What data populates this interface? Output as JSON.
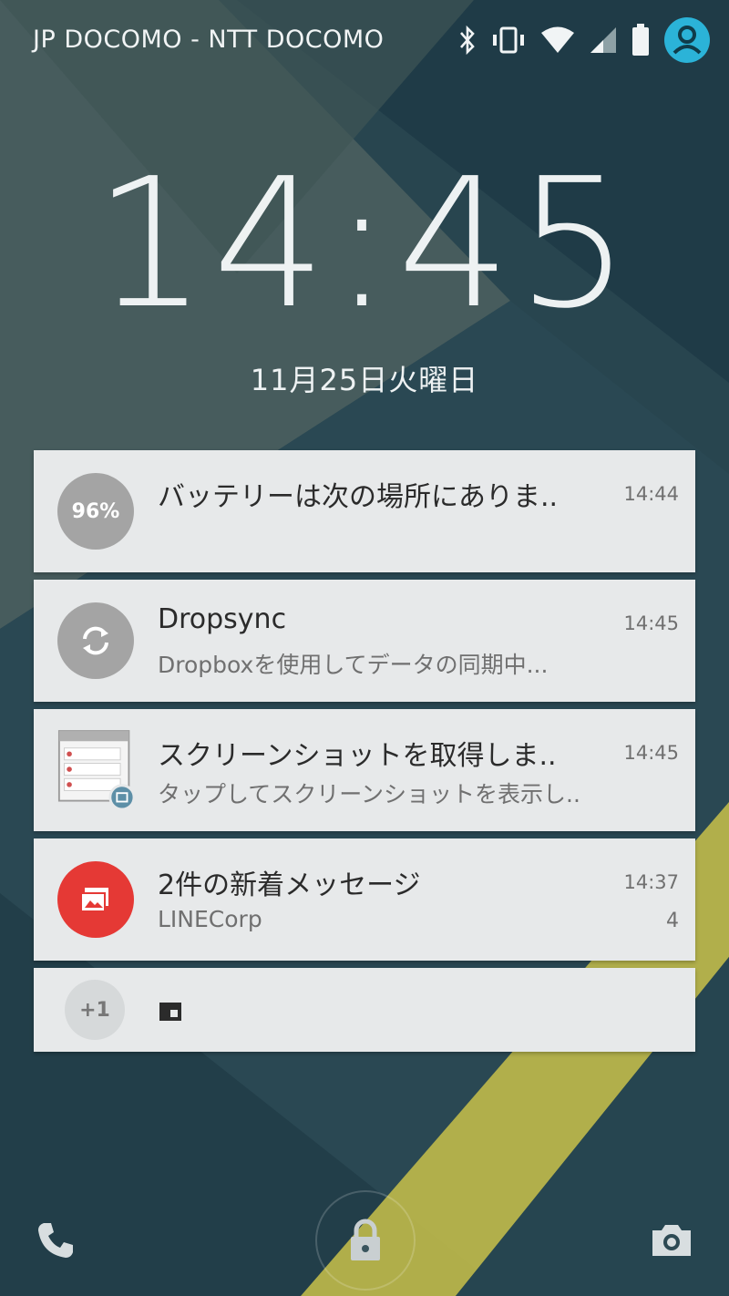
{
  "status_bar": {
    "carrier": "JP DOCOMO - NTT DOCOMO",
    "icons": [
      "bluetooth-icon",
      "vibrate-icon",
      "wifi-icon",
      "signal-icon",
      "battery-icon",
      "user-avatar-icon"
    ],
    "accent_color": "#2bb3d8"
  },
  "lockscreen": {
    "time": "14:45",
    "date": "11月25日火曜日"
  },
  "notifications": [
    {
      "title": "バッテリーは次の場所にありま..",
      "text": "",
      "time": "14:44",
      "icon": "battery-percent-icon",
      "icon_text": "96%",
      "icon_color": "#a0a0a0"
    },
    {
      "title": "Dropsync",
      "text": "Dropboxを使用してデータの同期中...",
      "time": "14:45",
      "icon": "sync-icon",
      "icon_color": "#a0a0a0"
    },
    {
      "title": "スクリーンショットを取得しま..",
      "text": "タップしてスクリーンショットを表示し..",
      "time": "14:45",
      "icon": "screenshot-thumbnail-icon"
    },
    {
      "title": "2件の新着メッセージ",
      "text": "LINECorp",
      "time": "14:37",
      "count": "4",
      "icon": "message-icon",
      "icon_color": "#e53935"
    },
    {
      "more_label": "+1",
      "icon": "app-small-icon"
    }
  ],
  "bottom_bar": {
    "icons": [
      "phone-icon",
      "lock-icon",
      "camera-icon"
    ]
  }
}
